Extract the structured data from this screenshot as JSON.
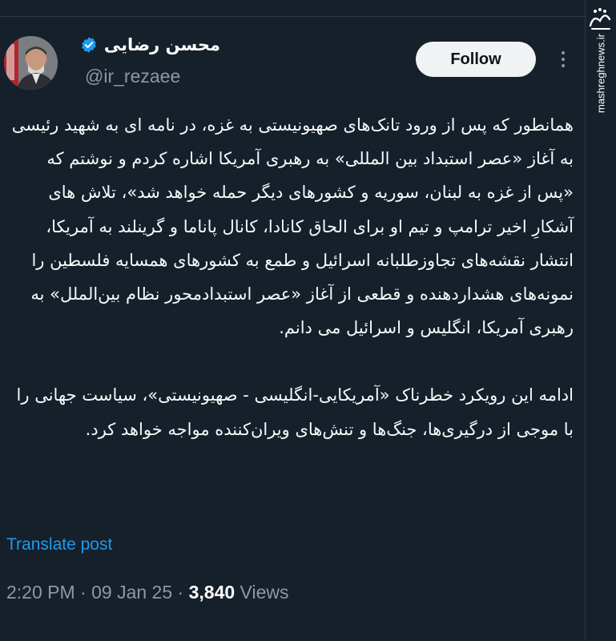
{
  "post": {
    "author_name": "محسن رضایی",
    "author_handle": "@ir_rezaee",
    "verified": true,
    "follow_label": "Follow",
    "paragraphs": [
      "همانطور که پس از ورود تانک‌های صهیونیستی به غزه، در نامه ای به شهید رئیسی به آغاز «عصر استبداد بین المللی» به رهبری آمریکا اشاره کردم و نوشتم که «پس از غزه به لبنان، سوریه و کشورهای دیگر حمله خواهد شد»، تلاش های آشکارِ اخیر ترامپ و تیم او برای الحاق کانادا، کانال پاناما و گرینلند به آمریکا، انتشار نقشه‌های تجاوزطلبانه اسرائیل و طمع به کشورهای همسایه فلسطین را نمونه‌های هشداردهنده و قطعی از آغاز «عصر استبدادمحور نظام بین‌الملل» به رهبری آمریکا، انگلیس و اسرائیل می دانم.",
      "ادامه این رویکرد خطرناک «آمریکایی-انگلیسی - صهیونیستی»، سیاست جهانی را با موجی از درگیری‌ها، جنگ‌ها و تنش‌های ویران‌کننده مواجه خواهد کرد."
    ],
    "translate_label": "Translate post",
    "time": "2:20 PM",
    "date": "09 Jan 25",
    "views_count": "3,840",
    "views_label": "Views"
  },
  "watermark": {
    "text": "mashreghnews.ir",
    "logo_text": "مشرق"
  },
  "colors": {
    "background": "#15202b",
    "text": "#f7f9f9",
    "secondary": "#8b98a5",
    "link": "#1d9bf0",
    "verified": "#1d9bf0",
    "button_bg": "#eff3f4"
  },
  "icons": {
    "verified": "verified-badge-icon",
    "more": "more-options-icon"
  }
}
